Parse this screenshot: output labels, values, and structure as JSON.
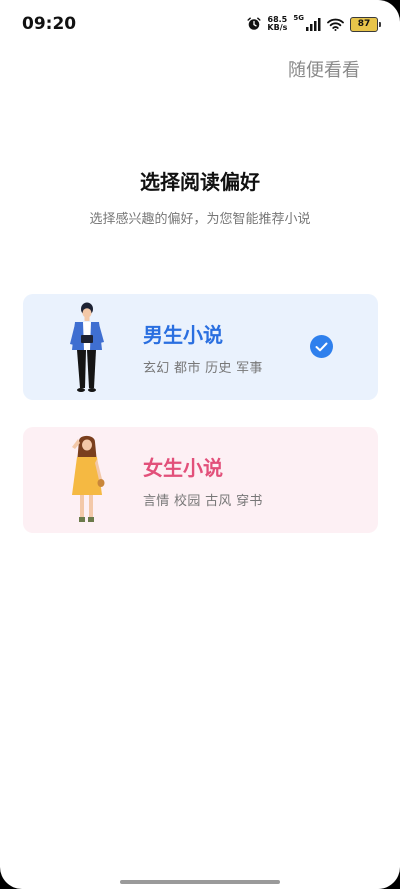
{
  "status_bar": {
    "time": "09:20",
    "net_speed_value": "68.5",
    "net_speed_unit": "KB/s",
    "network_type": "5G",
    "battery": "87",
    "icons": [
      "alarm-icon",
      "signal-icon",
      "wifi-icon",
      "battery-icon"
    ]
  },
  "skip_label": "随便看看",
  "title": "选择阅读偏好",
  "subtitle": "选择感兴趣的偏好，为您智能推荐小说",
  "options": [
    {
      "title": "男生小说",
      "tags": "玄幻 都市 历史 军事",
      "selected": true,
      "accent": "#2a6fe0",
      "background": "#eaf2fd"
    },
    {
      "title": "女生小说",
      "tags": "言情 校园 古风 穿书",
      "selected": false,
      "accent": "#e2507a",
      "background": "#fdf0f4"
    }
  ],
  "colors": {
    "check": "#2f80ed"
  }
}
